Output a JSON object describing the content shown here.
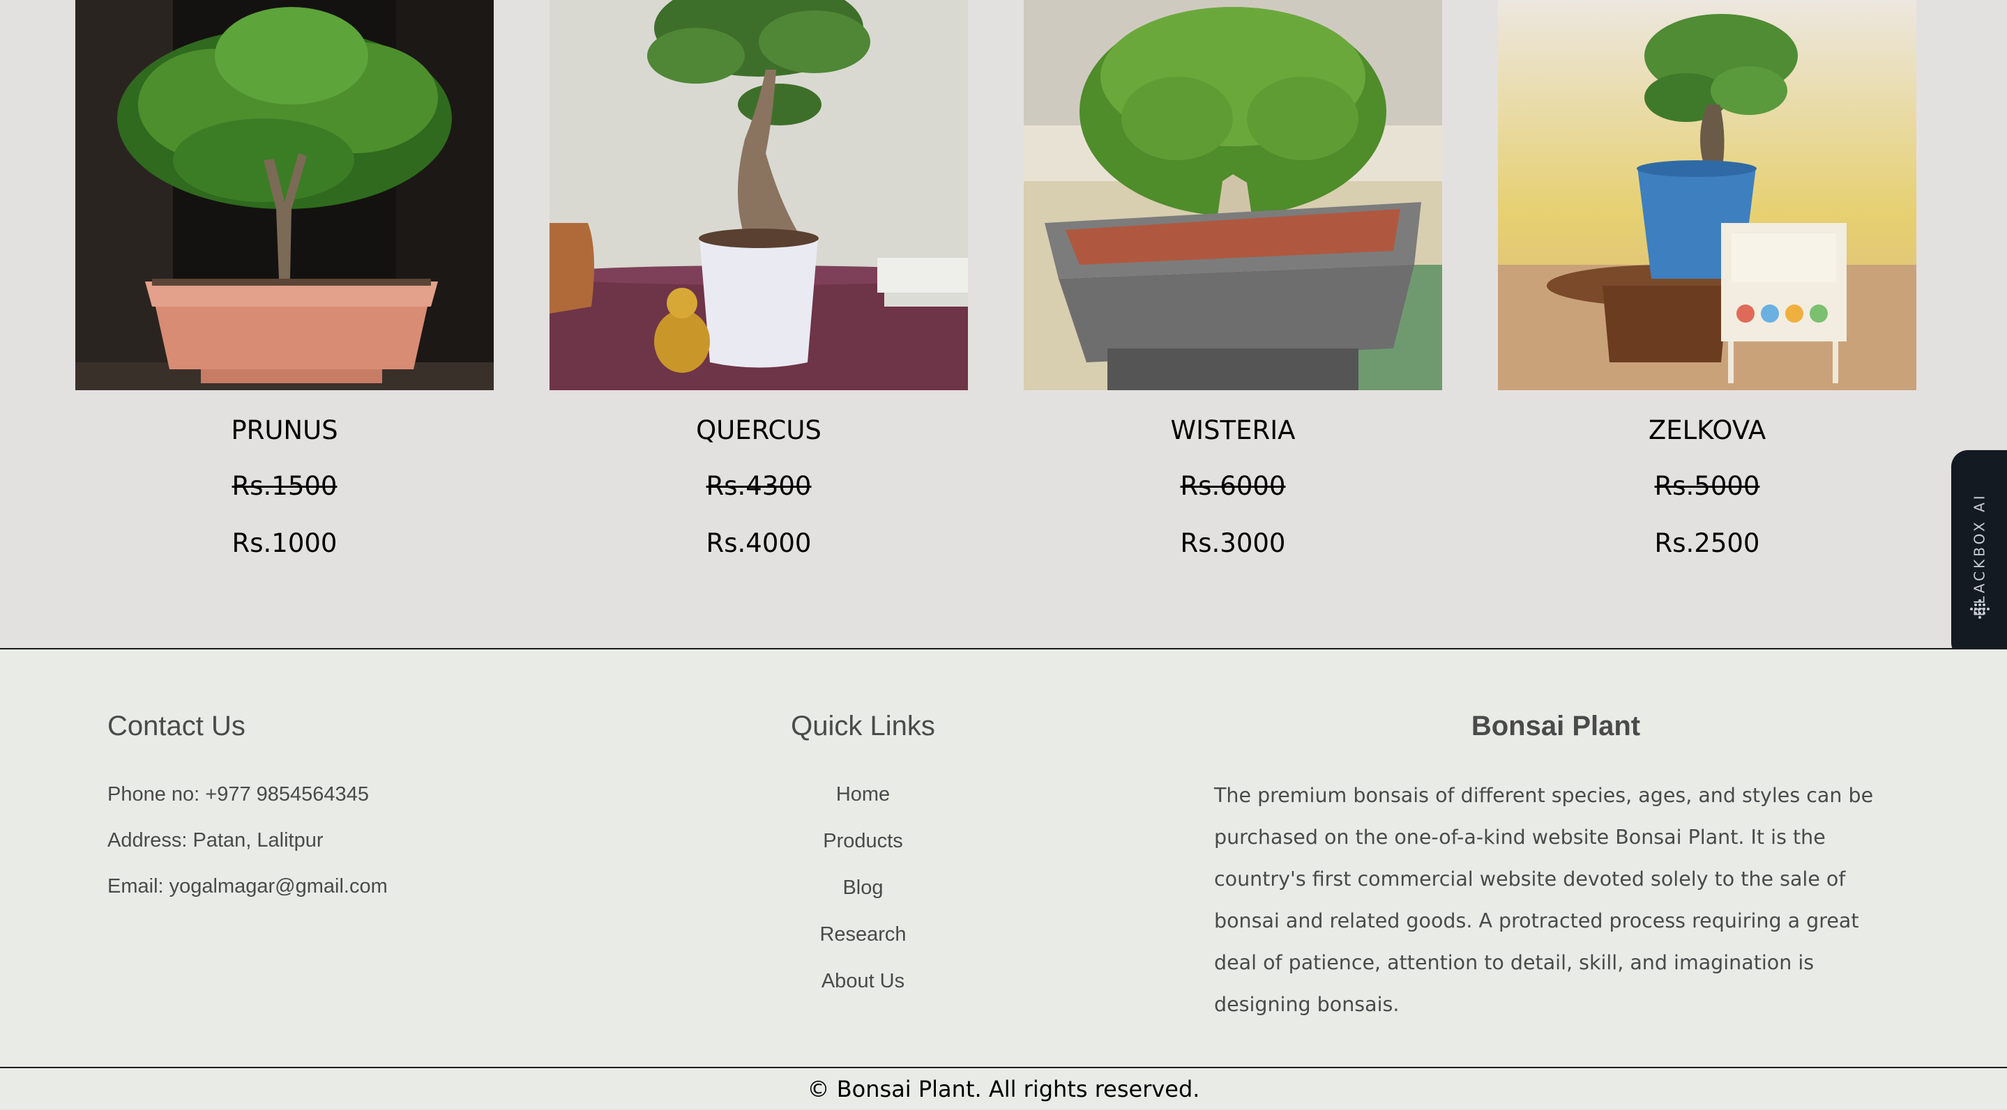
{
  "products": [
    {
      "name": "PRUNUS",
      "old_price": "Rs.1500",
      "price": "Rs.1000"
    },
    {
      "name": "QUERCUS",
      "old_price": "Rs.4300",
      "price": "Rs.4000"
    },
    {
      "name": "WISTERIA",
      "old_price": "Rs.6000",
      "price": "Rs.3000"
    },
    {
      "name": "ZELKOVA",
      "old_price": "Rs.5000",
      "price": "Rs.2500"
    }
  ],
  "blackbox": {
    "label": "BLACKBOX AI"
  },
  "footer": {
    "contact": {
      "title": "Contact Us",
      "phone": "Phone no: +977 9854564345",
      "address": "Address: Patan, Lalitpur",
      "email": "Email: yogalmagar@gmail.com"
    },
    "quick_links": {
      "title": "Quick Links",
      "items": [
        "Home",
        "Products",
        "Blog",
        "Research",
        "About Us"
      ]
    },
    "about": {
      "title": "Bonsai Plant",
      "text": "The premium bonsais of different species, ages, and styles can be purchased on the one-of-a-kind website Bonsai Plant. It is the country's first commercial website devoted solely to the sale of bonsai and related goods. A protracted process requiring a great deal of patience, attention to detail, skill, and imagination is designing bonsais."
    }
  },
  "copyright": "© Bonsai Plant. All rights reserved."
}
